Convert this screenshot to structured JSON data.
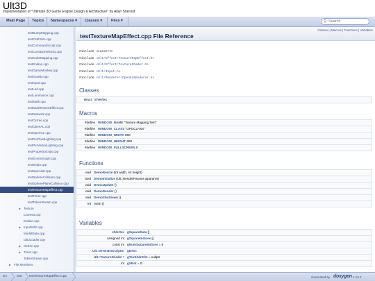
{
  "project": {
    "name": "Ult3D",
    "brief": "Implementation of \"Ultimate 3D Game Engine Design & Architecture\" by Allan Sherrod"
  },
  "navbar": {
    "tabs": [
      "Main Page",
      "Topics",
      "Namespaces ▾",
      "Classes ▾",
      "Files ▾"
    ],
    "search_placeholder": "Search",
    "search_icon": "search-icon"
  },
  "sidenav": {
    "items": [
      {
        "label": "testBumpMapping.cpp",
        "indent": 2,
        "arrow": false
      },
      {
        "label": "testClothSim.cpp",
        "indent": 2,
        "arrow": false
      },
      {
        "label": "testCommandScript.cpp",
        "indent": 2,
        "arrow": false
      },
      {
        "label": "testConstantVelocity.cpp",
        "indent": 2,
        "arrow": false
      },
      {
        "label": "testCubeMapping.cpp",
        "indent": 2,
        "arrow": false
      },
      {
        "label": "testEndian.cpp",
        "indent": 2,
        "arrow": false
      },
      {
        "label": "testGameMonkey.cpp",
        "indent": 2,
        "arrow": false
      },
      {
        "label": "testGravity.cpp",
        "indent": 2,
        "arrow": false
      },
      {
        "label": "testInput.cpp",
        "indent": 2,
        "arrow": false
      },
      {
        "label": "testLod.cpp",
        "indent": 2,
        "arrow": false
      },
      {
        "label": "testLuminance.cpp",
        "indent": 2,
        "arrow": false
      },
      {
        "label": "testMath.cpp",
        "indent": 2,
        "arrow": false
      },
      {
        "label": "testMultiTextureEffect.cpp",
        "indent": 2,
        "arrow": false
      },
      {
        "label": "testNetwork.cpp",
        "indent": 2,
        "arrow": false
      },
      {
        "label": "testOctree.cpp",
        "indent": 2,
        "arrow": false
      },
      {
        "label": "testOpenAL.cpp",
        "indent": 2,
        "arrow": false
      },
      {
        "label": "testOpenGL.cpp",
        "indent": 2,
        "arrow": false
      },
      {
        "label": "testPerPixelLighting.cpp",
        "indent": 2,
        "arrow": false
      },
      {
        "label": "testPerVertexLighting.cpp",
        "indent": 2,
        "arrow": false
      },
      {
        "label": "testPropertyScript.cpp",
        "indent": 2,
        "arrow": false
      },
      {
        "label": "testSceneGraph.cpp",
        "indent": 2,
        "arrow": false
      },
      {
        "label": "testSepia.cpp",
        "indent": 2,
        "arrow": false
      },
      {
        "label": "testSpecular.cpp",
        "indent": 2,
        "arrow": false
      },
      {
        "label": "testSphereCollision.cpp",
        "indent": 2,
        "arrow": false
      },
      {
        "label": "testSpherePlaneCollision.cpp",
        "indent": 2,
        "arrow": false
      },
      {
        "label": "testTextureMapEffect.cpp",
        "indent": 2,
        "arrow": false,
        "selected": true
      },
      {
        "label": "testTimer.cpp",
        "indent": 2,
        "arrow": false
      },
      {
        "label": "testTokenStream.cpp",
        "indent": 2,
        "arrow": false
      },
      {
        "label": "Texture",
        "indent": 1,
        "arrow": true
      },
      {
        "label": "Camera.cpp",
        "indent": 1,
        "arrow": false
      },
      {
        "label": "Endian.cpp",
        "indent": 1,
        "arrow": false
      },
      {
        "label": "InputSdl2.cpp",
        "indent": 1,
        "arrow": true
      },
      {
        "label": "ModelData.cpp",
        "indent": 1,
        "arrow": false
      },
      {
        "label": "OBJLoader.cpp",
        "indent": 1,
        "arrow": false
      },
      {
        "label": "Octree.cpp",
        "indent": 1,
        "arrow": true
      },
      {
        "label": "Timer.cpp",
        "indent": 1,
        "arrow": true
      },
      {
        "label": "TokenStream.cpp",
        "indent": 1,
        "arrow": false
      },
      {
        "label": "File Members",
        "indent": 0,
        "arrow": true
      }
    ]
  },
  "content": {
    "summary_links": "Classes | Macros | Functions | Variables",
    "title": "testTextureMapEffect.cpp File Reference",
    "includes": [
      {
        "prefix": "#include ",
        "path": "<cassert>",
        "linked": false
      },
      {
        "prefix": "#include ",
        "path": "<Ult/Effect/TextureMapEffect.h>",
        "linked": true
      },
      {
        "prefix": "#include ",
        "path": "<Ult/Effect/TextureShader.h>",
        "linked": true
      },
      {
        "prefix": "#include ",
        "path": "<Ult/Input.h>",
        "linked": true
      },
      {
        "prefix": "#include ",
        "path": "<Ult/Renderer/OpenGLRenderer.h>",
        "linked": true
      }
    ],
    "classes": {
      "heading": "Classes",
      "rows": [
        {
          "left": "struct",
          "name": "stVertex",
          "rest": ""
        }
      ]
    },
    "macros": {
      "heading": "Macros",
      "rows": [
        {
          "left": "#define",
          "name": "WINDOW_NAME",
          "rest": "  \"Texture Mapping Test\""
        },
        {
          "left": "#define",
          "name": "WINDOW_CLASS",
          "rest": "  \"UPGCLASS\""
        },
        {
          "left": "#define",
          "name": "WINDOW_WIDTH",
          "rest": "  800"
        },
        {
          "left": "#define",
          "name": "WINDOW_HEIGHT",
          "rest": "  600"
        },
        {
          "left": "#define",
          "name": "WINDOW_FULLSCREEN",
          "rest": "  0"
        }
      ]
    },
    "functions": {
      "heading": "Functions",
      "rows": [
        {
          "left": "void",
          "name": "DemoResize",
          "rest": " (int width, int height)"
        },
        {
          "left": "bool",
          "name": "DemoInitialize",
          "rest": " (Ult::RenderParams &params)"
        },
        {
          "left": "void",
          "name": "DemoUpdate",
          "rest": " ()"
        },
        {
          "left": "void",
          "name": "DemoRender",
          "rest": " ()"
        },
        {
          "left": "void",
          "name": "DemoShutdown",
          "rest": " ()"
        },
        {
          "left": "int",
          "name": "main",
          "rest": " ()"
        }
      ]
    },
    "variables": {
      "heading": "Variables",
      "rows": [
        {
          "left": "stVertex",
          "left_link": true,
          "name": "gSquareData",
          "rest": " []"
        },
        {
          "left": "unsigned int",
          "left_link": false,
          "name": "gSquareIndices",
          "rest": " []"
        },
        {
          "left": "const int",
          "left_link": false,
          "name": "gNumSquareIndices",
          "rest": " = 6"
        },
        {
          "left": "Ult::VertexDescriptor",
          "left_link": true,
          "name": "gDesc",
          "rest": ""
        },
        {
          "left": "Ult::TextureShader *",
          "left_link": true,
          "name": "gTexShdrEfct",
          "rest": " = nullptr"
        },
        {
          "left": "int",
          "left_link": false,
          "name": "gXRot",
          "rest": " = 0"
        }
      ]
    }
  },
  "footer": {
    "crumbs": [
      "src",
      "test",
      "testTextureMapEffect.cpp"
    ],
    "generated_by": "Generated by",
    "logo_text": "doxygen",
    "version": "1.13.2"
  }
}
